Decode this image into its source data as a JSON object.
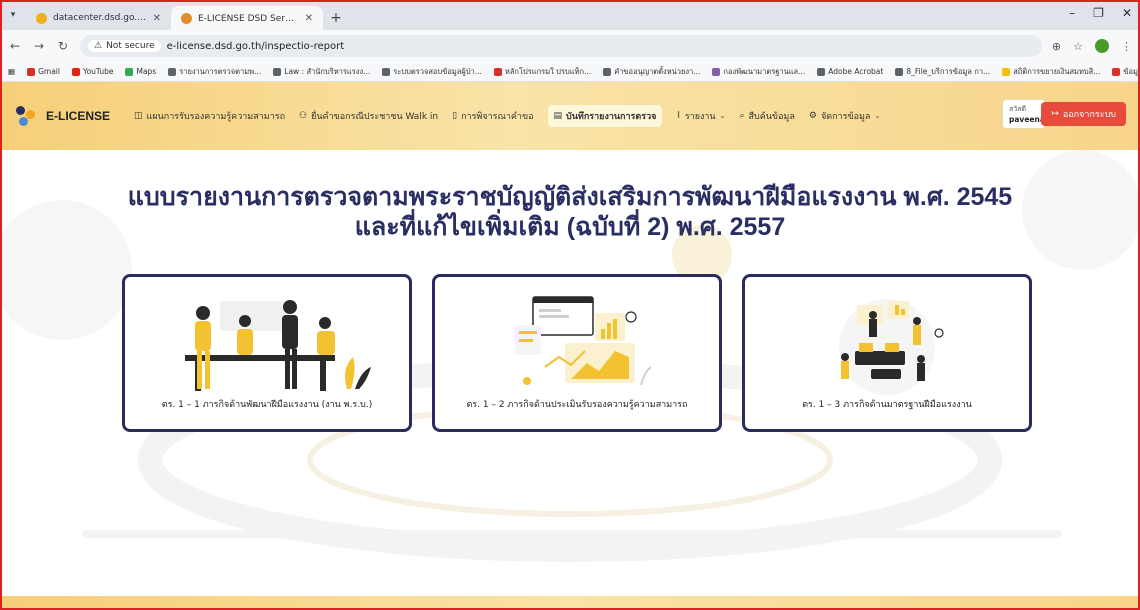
{
  "browser": {
    "tabs": [
      {
        "title": "datacenter.dsd.go.th |",
        "favicon_color": "#f2b01e",
        "active": false
      },
      {
        "title": "E-LICENSE DSD Service - ระบบใบ",
        "favicon_color": "#e58b2a",
        "active": true
      }
    ],
    "address": {
      "security_label": "Not secure",
      "url": "e-license.dsd.go.th/inspectio-report"
    },
    "bookmarks": [
      {
        "label": "Gmail",
        "color": "#d93025"
      },
      {
        "label": "YouTube",
        "color": "#e62117"
      },
      {
        "label": "Maps",
        "color": "#34a853"
      },
      {
        "label": "รายงานการตรวจตามพ...",
        "color": "#5f6368"
      },
      {
        "label": "Law : สำนักบริหารแรงง...",
        "color": "#5f6368"
      },
      {
        "label": "ระบบตรวจสอบข้อมูลผู้ป่า...",
        "color": "#5f6368"
      },
      {
        "label": "หลักโปรแกรมใ ปรบแท็ก...",
        "color": "#d93025"
      },
      {
        "label": "คำขออนุญาตตั้งหน่วยงา...",
        "color": "#5f6368"
      },
      {
        "label": "กองพัฒนามาตรฐานแล...",
        "color": "#7b5fa8"
      },
      {
        "label": "Adobe Acrobat",
        "color": "#5f6368"
      },
      {
        "label": "8_File_บริการข้อมูล กา...",
        "color": "#5f6368"
      },
      {
        "label": "สถิติการขยายเงินสมทบสิ...",
        "color": "#f2c100"
      },
      {
        "label": "ข้อมูลสำหรับผู้ประกอบ...",
        "color": "#d93025"
      }
    ]
  },
  "app": {
    "brand": "E-LICENSE",
    "menu": [
      {
        "label": "แผนการรับรองความรู้ความสามารถ",
        "icon": "book-icon",
        "active": false,
        "dropdown": false
      },
      {
        "label": "ยื่นคำขอกรณีประชาชน Walk in",
        "icon": "user-plus-icon",
        "active": false,
        "dropdown": false
      },
      {
        "label": "การพิจารณาคำขอ",
        "icon": "clipboard-icon",
        "active": false,
        "dropdown": false
      },
      {
        "label": "บันทึกรายงานการตรวจ",
        "icon": "document-icon",
        "active": true,
        "dropdown": false
      },
      {
        "label": "รายงาน",
        "icon": "chart-icon",
        "active": false,
        "dropdown": true
      },
      {
        "label": "สืบค้นข้อมูล",
        "icon": "search-icon",
        "active": false,
        "dropdown": false
      },
      {
        "label": "จัดการข้อมูล",
        "icon": "gear-icon",
        "active": false,
        "dropdown": true
      }
    ],
    "user": {
      "greeting": "สวัสดี",
      "name": "paveenat"
    },
    "logout_label": "ออกจากระบบ",
    "colors": {
      "nav": "#f6cf78",
      "heading": "#2a2f63",
      "card_border": "#2b2c5e",
      "logout": "#e84a3c",
      "accent": "#f2c230"
    }
  },
  "page": {
    "heading_line1": "แบบรายงานการตรวจตามพระราชบัญญัติส่งเสริมการพัฒนาฝีมือแรงงาน พ.ศ. 2545",
    "heading_line2": "และที่แก้ไขเพิ่มเติม (ฉบับที่ 2) พ.ศ. 2557",
    "cards": [
      {
        "label": "ตร. 1 – 1 ภารกิจด้านพัฒนาฝีมือแรงงาน (งาน พ.ร.บ.)",
        "illustration": "team-meeting-illustration"
      },
      {
        "label": "ตร. 1 – 2 ภารกิจด้านประเมินรับรองความรู้ความสามารถ",
        "illustration": "dashboard-analytics-illustration"
      },
      {
        "label": "ตร. 1 – 3 ภารกิจด้านมาตรฐานฝีมือแรงงาน",
        "illustration": "office-workers-illustration"
      }
    ]
  }
}
